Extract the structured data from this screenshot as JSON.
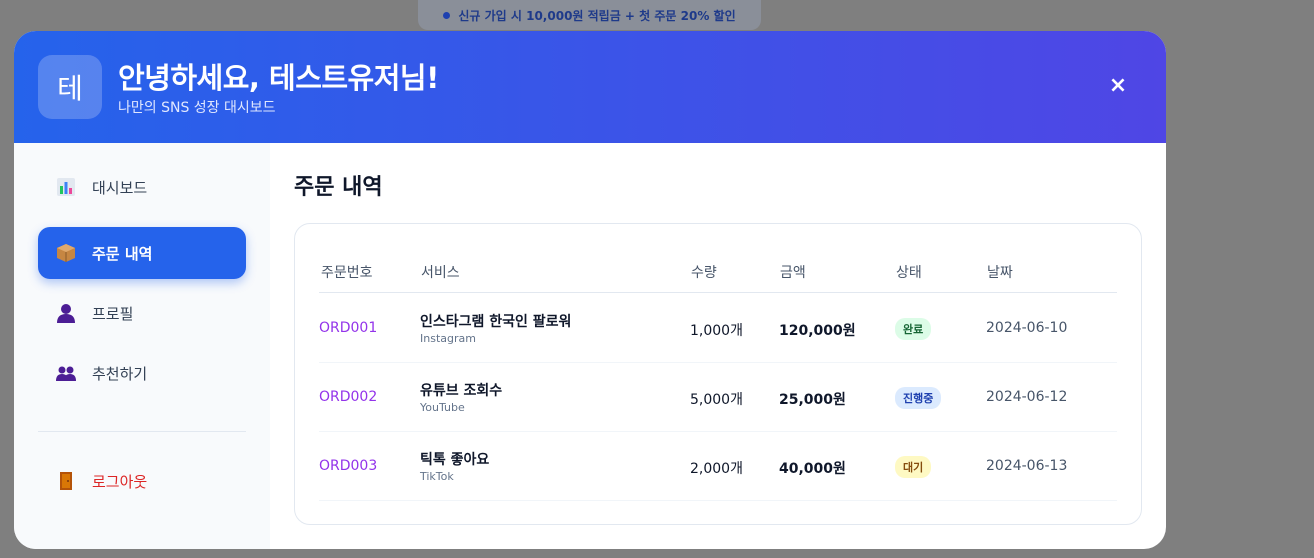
{
  "promo": {
    "text": "신규 가입 시 10,000원 적립금 + 첫 주문 20% 할인"
  },
  "header": {
    "avatar_letter": "테",
    "greeting": "안녕하세요, 테스트유저님!",
    "subtitle": "나만의 SNS 성장 대시보드",
    "close_label": "×"
  },
  "sidebar": {
    "items": [
      {
        "label": "대시보드",
        "icon": "chart-icon",
        "active": false
      },
      {
        "label": "주문 내역",
        "icon": "package-icon",
        "active": true
      },
      {
        "label": "프로필",
        "icon": "user-icon",
        "active": false
      },
      {
        "label": "추천하기",
        "icon": "users-icon",
        "active": false
      }
    ],
    "logout": {
      "label": "로그아웃",
      "icon": "door-icon"
    }
  },
  "main": {
    "title": "주문 내역",
    "table": {
      "headers": [
        "주문번호",
        "서비스",
        "수량",
        "금액",
        "상태",
        "날짜"
      ],
      "rows": [
        {
          "id": "ORD001",
          "service": "인스타그램 한국인 팔로워",
          "platform": "Instagram",
          "qty": "1,000개",
          "amount": "120,000원",
          "status": "완료",
          "date": "2024-06-10"
        },
        {
          "id": "ORD002",
          "service": "유튜브 조회수",
          "platform": "YouTube",
          "qty": "5,000개",
          "amount": "25,000원",
          "status": "진행중",
          "date": "2024-06-12"
        },
        {
          "id": "ORD003",
          "service": "틱톡 좋아요",
          "platform": "TikTok",
          "qty": "2,000개",
          "amount": "40,000원",
          "status": "대기",
          "date": "2024-06-13"
        }
      ]
    }
  },
  "colors": {
    "status_done_bg": "#dcfce7",
    "status_done_fg": "#166534",
    "status_progress_bg": "#dbeafe",
    "status_progress_fg": "#1e40af",
    "status_wait_bg": "#fef9c3",
    "status_wait_fg": "#854d0e"
  }
}
